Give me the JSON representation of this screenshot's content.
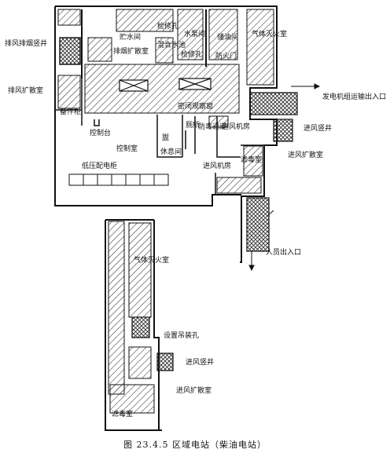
{
  "labels": {
    "exhaust_smoke_shaft": "排风排烟竖井",
    "exhaust_expansion": "排风扩散室",
    "spare_parts": "备件柜",
    "water_tank": "贮水间",
    "smoke_expansion": "排烟扩散室",
    "inspection_hole_1": "检修孔",
    "inspection_hole_2": "检修孔",
    "water_pump": "水泵间",
    "mixing_pool": "混合水池",
    "oil_store": "储油间",
    "fire_door": "防火门",
    "gas_extinguish": "气体灭火室",
    "sealed_window": "密闭观察窗",
    "console": "控制台",
    "control_room": "控制室",
    "low_voltage": "低压配电柜",
    "toilet": "厕所",
    "washroom": "盥",
    "rest_room": "休息间",
    "decontam_passage": "防毒通道",
    "intake_machine_room_1": "进风机房",
    "intake_machine_room_2": "进风机房",
    "filter_room": "滤毒室",
    "genset_entrance": "发电机组运输出入口",
    "intake_shaft": "进风竖井",
    "intake_expansion": "进风扩散室",
    "personnel_entrance": "人员出入口",
    "lower_gas_extinguish": "气体灭火室",
    "lifting_hole": "设置吊装孔",
    "lower_intake_shaft": "进风竖井",
    "lower_intake_expansion": "进风扩散室",
    "lower_filter_room": "滤毒室"
  },
  "caption": "图 23.4.5   区域电站（柴油电站）"
}
